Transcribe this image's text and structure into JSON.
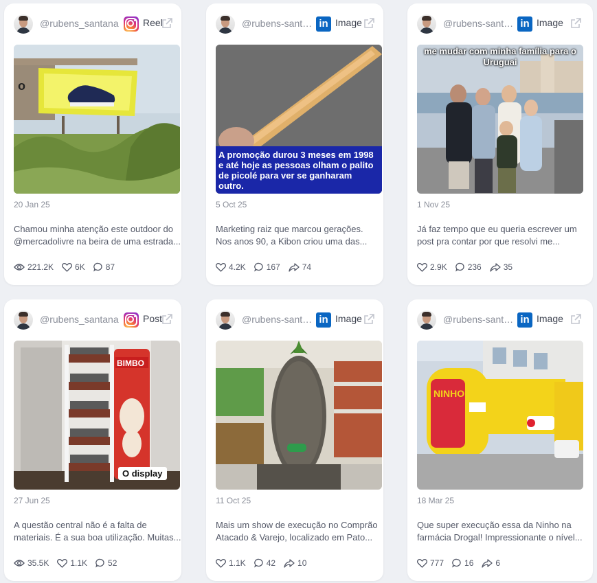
{
  "cards": [
    {
      "handle": "@rubens_santana",
      "network": "instagram",
      "type_label": "Reel",
      "date": "20 Jan 25",
      "desc_line1": "Chamou minha atenção este outdoor do",
      "desc_line2": "@mercadolivre na beira de uma estrada...",
      "stats": {
        "views": "221.2K",
        "likes": "6K",
        "comments": "87"
      }
    },
    {
      "handle": "@rubens-santana",
      "network": "linkedin",
      "type_label": "Image",
      "date": "5 Oct 25",
      "desc_line1": "Marketing raiz que marcou gerações.",
      "desc_line2": "Nos anos 90, a Kibon criou uma das...",
      "overlay_text": "A promoção durou 3 meses em 1998 e até hoje as pessoas olham o palito de picolé para ver se ganharam outro.",
      "stats": {
        "likes": "4.2K",
        "comments": "167",
        "shares": "74"
      }
    },
    {
      "handle": "@rubens-santana",
      "network": "linkedin",
      "type_label": "Image",
      "date": "1 Nov 25",
      "desc_line1": "Já faz tempo que eu queria escrever um",
      "desc_line2": "post pra contar por que resolvi me...",
      "overlay_text": "me mudar com minha família para o Uruguai",
      "stats": {
        "likes": "2.9K",
        "comments": "236",
        "shares": "35"
      }
    },
    {
      "handle": "@rubens_santana",
      "network": "instagram",
      "type_label": "Post",
      "date": "27 Jun 25",
      "desc_line1": "A questão central não é a falta de",
      "desc_line2": "materiais. É a sua boa utilização. Muitas...",
      "overlay_text": "O display",
      "stats": {
        "views": "35.5K",
        "likes": "1.1K",
        "comments": "52"
      }
    },
    {
      "handle": "@rubens-santana",
      "network": "linkedin",
      "type_label": "Image",
      "date": "11 Oct 25",
      "desc_line1": "Mais um show de execução no Comprão",
      "desc_line2": "Atacado & Varejo, localizado em Pato...",
      "stats": {
        "likes": "1.1K",
        "comments": "42",
        "shares": "10"
      }
    },
    {
      "handle": "@rubens-santana",
      "network": "linkedin",
      "type_label": "Image",
      "date": "18 Mar 25",
      "desc_line1": "Que super execução essa da Ninho na",
      "desc_line2": "farmácia Drogal! Impressionante o nível...",
      "stats": {
        "likes": "777",
        "comments": "16",
        "shares": "6"
      }
    }
  ],
  "colors": {
    "instagram": "#d92f7f",
    "linkedin": "#0a66c2",
    "caption_bg": "#1a27a8"
  },
  "icons": {
    "views": "eye-icon",
    "likes": "heart-icon",
    "comments": "comment-icon",
    "shares": "share-icon",
    "external": "external-link-icon"
  }
}
